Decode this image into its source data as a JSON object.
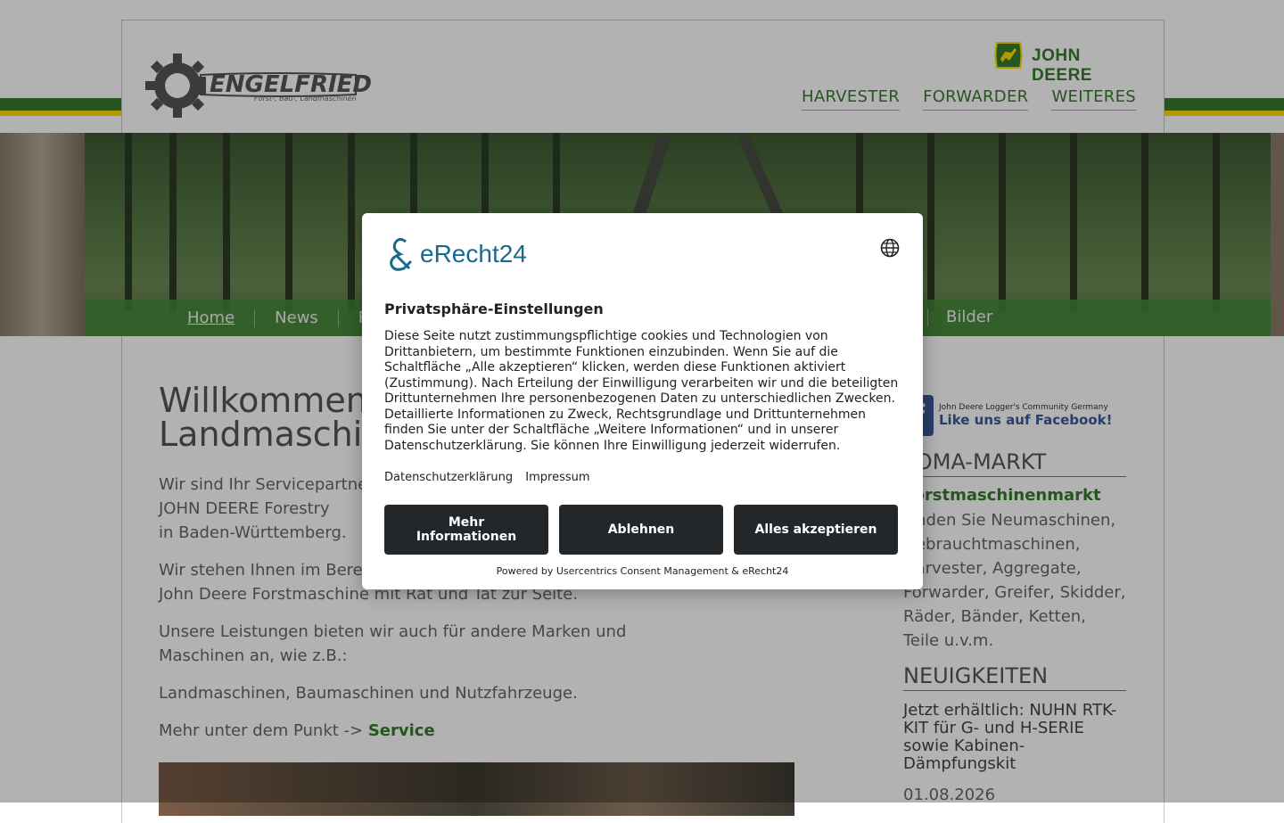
{
  "header": {
    "company_name": "ENGELFRIED",
    "company_tagline": "Forst-, Bau-, Landmaschinen",
    "brand": "JOHN DEERE",
    "top_nav": [
      "HARVESTER",
      "FORWARDER",
      "WEITERES"
    ]
  },
  "sub_nav": {
    "items": [
      "Home",
      "News",
      "FOM"
    ],
    "active": "Home",
    "last_item": "Bilder"
  },
  "main": {
    "title_line1": "Willkommen b",
    "title_line2": "Landmaschin",
    "p1_line1": "Wir sind Ihr Servicepartner fü",
    "p1_line2": "JOHN DEERE Forestry",
    "p1_line3": "in Baden-Württemberg.",
    "p2_line1": "Wir stehen Ihnen im Bereich",
    "p2_line2": "John Deere Forstmaschine mit Rat und Tat zur Seite.",
    "p3": "Unsere Leistungen bieten wir auch für andere Marken und Maschinen an, wie z.B.:",
    "p4": "Landmaschinen, Baumaschinen und Nutzfahrzeuge.",
    "p5_prefix": "Mehr unter dem Punkt ->",
    "p5_link": "Service"
  },
  "aside": {
    "facebook_small": "John Deere Logger's Community Germany",
    "facebook_big": "Like uns auf Facebook!",
    "fomamarkt_title": "FOMA-MARKT",
    "fomamarkt_link": "Forstmaschinenmarkt",
    "fomamarkt_text": "Finden Sie Neumaschinen, Gebrauchtmaschinen, Harvester, Aggregate, Forwarder, Greifer, Skidder, Räder, Bänder, Ketten, Teile u.v.m.",
    "news_title": "NEUIGKEITEN",
    "news_item": "Jetzt erhältlich: NUHN RTK-KIT für G- und H-SERIE sowie Kabinen-Dämpfungskit",
    "news_date": "01.08.2026"
  },
  "consent": {
    "logo_text": "eRecht24",
    "title": "Privatsphäre-Einstellungen",
    "description": "Diese Seite nutzt zustimmungspflichtige cookies und Technologien von Drittanbietern, um bestimmte Funktionen einzubinden. Wenn Sie auf die Schaltfläche „Alle akzeptieren“ klicken, werden diese Funktionen aktiviert (Zustimmung). Nach Erteilung der Einwilligung verarbeiten wir und die beteiligten Drittunternehmen Ihre personenbezogenen Daten zu unterschiedlichen Zwecken. Detaillierte Informationen zu Zweck, Rechtsgrundlage und Drittunternehmen finden Sie unter der Schaltfläche „Weitere Informationen“ und in unserer Datenschutzerklärung. Sie können Ihre Einwilligung jederzeit widerrufen.",
    "link_privacy": "Datenschutzerklärung",
    "link_imprint": "Impressum",
    "btn_more": "Mehr Informationen",
    "btn_decline": "Ablehnen",
    "btn_accept": "Alles akzeptieren",
    "powered_by": "Powered by Usercentrics Consent Management & eRecht24"
  },
  "colors": {
    "jd_green": "#367c2b",
    "jd_yellow": "#ffde00",
    "button_dark": "#23272a",
    "erecht_blue": "#1a6a8e"
  }
}
